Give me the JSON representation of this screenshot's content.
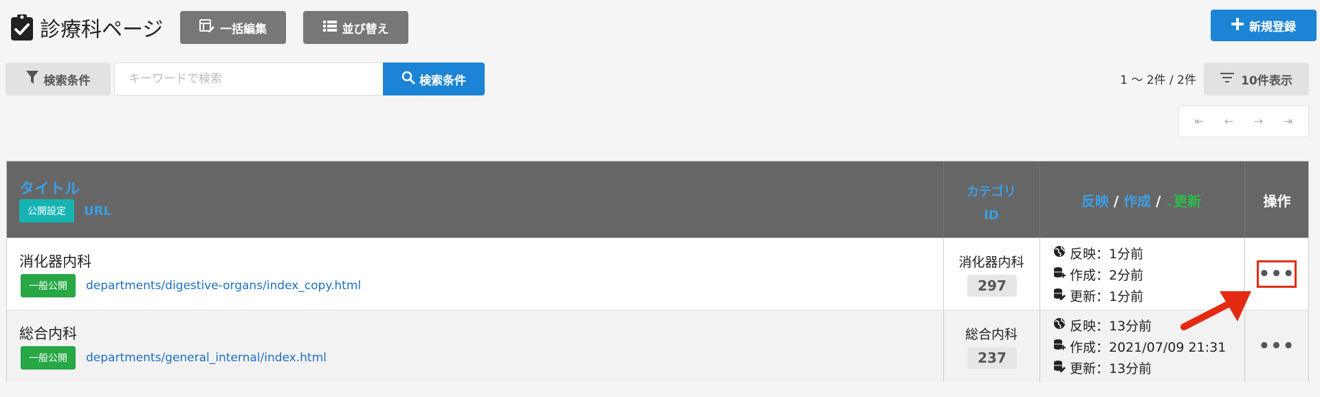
{
  "header": {
    "title": "診療科ページ",
    "bulk_edit_label": "一括編集",
    "sort_label": "並び替え",
    "new_label": "新規登録"
  },
  "search": {
    "filter_label": "検索条件",
    "placeholder": "キーワードで検索",
    "value": "",
    "search_button_label": "検索条件"
  },
  "pagination": {
    "count_text": "1 〜 2件 / 2件",
    "per_page_label": "10件表示",
    "first": "⇤",
    "prev": "←",
    "next": "→",
    "last": "⇥"
  },
  "table": {
    "headers": {
      "title": "タイトル",
      "public_setting": "公開設定",
      "url": "URL",
      "category": "カテゴリ",
      "id": "ID",
      "reflect": "反映",
      "sep1": " / ",
      "created": "作成",
      "sep2": " / ",
      "sort_indicator": "⌄",
      "updated": "更新",
      "operation": "操作"
    },
    "rows": [
      {
        "title": "消化器内科",
        "status": "一般公開",
        "url": "departments/digestive-organs/index_copy.html",
        "category": "消化器内科",
        "id": "297",
        "reflect": "反映：1分前",
        "created": "作成：2分前",
        "updated": "更新：1分前",
        "more": "•••"
      },
      {
        "title": "総合内科",
        "status": "一般公開",
        "url": "departments/general_internal/index.html",
        "category": "総合内科",
        "id": "237",
        "reflect": "反映：13分前",
        "created": "作成：2021/07/09 21:31",
        "updated": "更新：13分前",
        "more": "•••"
      }
    ]
  },
  "colors": {
    "primary": "#1c84d6",
    "header_bg": "#666666",
    "link": "#3ba0e6",
    "green": "#28a745",
    "teal": "#17b3b3",
    "highlight": "#e52a14"
  }
}
